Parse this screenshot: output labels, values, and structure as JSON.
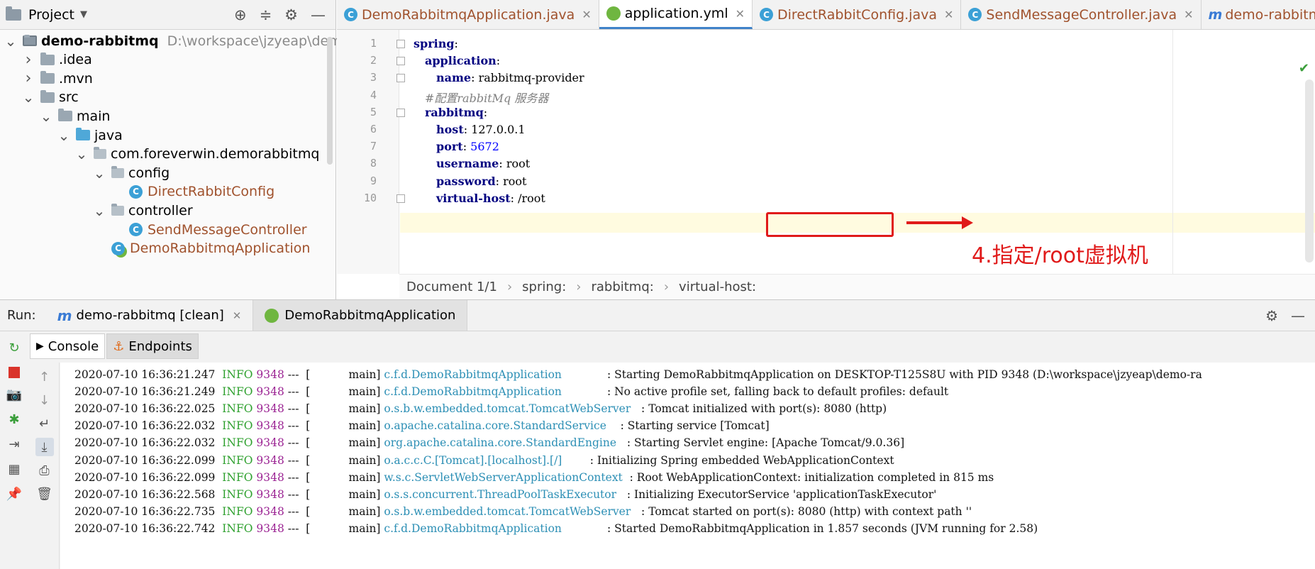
{
  "project_pane": {
    "title": "Project",
    "tree": [
      {
        "label": "demo-rabbitmq",
        "extra": "D:\\workspace\\jzyeap\\demo-ra",
        "depth": 0,
        "arrow": "down",
        "icon": "module-folder-icon"
      },
      {
        "label": ".idea",
        "depth": 1,
        "arrow": "right",
        "icon": "folder-icon"
      },
      {
        "label": ".mvn",
        "depth": 1,
        "arrow": "right",
        "icon": "folder-icon"
      },
      {
        "label": "src",
        "depth": 1,
        "arrow": "down",
        "icon": "folder-icon"
      },
      {
        "label": "main",
        "depth": 2,
        "arrow": "down",
        "icon": "folder-icon"
      },
      {
        "label": "java",
        "depth": 3,
        "arrow": "down",
        "icon": "source-folder-icon"
      },
      {
        "label": "com.foreverwin.demorabbitmq",
        "depth": 4,
        "arrow": "down",
        "icon": "package-icon"
      },
      {
        "label": "config",
        "depth": 5,
        "arrow": "down",
        "icon": "package-icon"
      },
      {
        "label": "DirectRabbitConfig",
        "depth": 6,
        "arrow": "",
        "icon": "class-icon"
      },
      {
        "label": "controller",
        "depth": 5,
        "arrow": "down",
        "icon": "package-icon"
      },
      {
        "label": "SendMessageController",
        "depth": 6,
        "arrow": "",
        "icon": "class-icon"
      },
      {
        "label": "DemoRabbitmqApplication",
        "depth": 5,
        "arrow": "",
        "icon": "spring-class-icon"
      }
    ]
  },
  "editor": {
    "tabs": [
      {
        "label": "DemoRabbitmqApplication.java",
        "icon": "spring-class-icon",
        "active": false
      },
      {
        "label": "application.yml",
        "icon": "yaml-spring-icon",
        "active": true
      },
      {
        "label": "DirectRabbitConfig.java",
        "icon": "class-icon",
        "active": false
      },
      {
        "label": "SendMessageController.java",
        "icon": "class-icon",
        "active": false
      },
      {
        "label": "demo-rabbitmq",
        "icon": "maven-icon",
        "active": false
      }
    ],
    "lines": [
      {
        "n": "1",
        "indent": 0,
        "key": "spring",
        "sep": ":",
        "value": "",
        "kind": "key",
        "fold": true
      },
      {
        "n": "2",
        "indent": 1,
        "key": "application",
        "sep": ":",
        "value": "",
        "kind": "key",
        "fold": true
      },
      {
        "n": "3",
        "indent": 2,
        "key": "name",
        "sep": ": ",
        "value": "rabbitmq-provider",
        "kind": "str",
        "fold": true
      },
      {
        "n": "4",
        "indent": 1,
        "key": "",
        "sep": "",
        "value": "#配置rabbitMq 服务器",
        "kind": "comment",
        "fold": false
      },
      {
        "n": "5",
        "indent": 1,
        "key": "rabbitmq",
        "sep": ":",
        "value": "",
        "kind": "key",
        "fold": true
      },
      {
        "n": "6",
        "indent": 2,
        "key": "host",
        "sep": ": ",
        "value": "127.0.0.1",
        "kind": "str",
        "fold": false
      },
      {
        "n": "7",
        "indent": 2,
        "key": "port",
        "sep": ": ",
        "value": "5672",
        "kind": "num",
        "fold": false
      },
      {
        "n": "8",
        "indent": 2,
        "key": "username",
        "sep": ": ",
        "value": "root",
        "kind": "str",
        "fold": false
      },
      {
        "n": "9",
        "indent": 2,
        "key": "password",
        "sep": ": ",
        "value": "root",
        "kind": "str",
        "fold": false
      },
      {
        "n": "10",
        "indent": 2,
        "key": "virtual-host",
        "sep": ": ",
        "value": "/root",
        "kind": "str",
        "fold": true
      }
    ],
    "annotation": "4.指定/root虚拟机",
    "breadcrumb": [
      "Document 1/1",
      "spring:",
      "rabbitmq:",
      "virtual-host:"
    ]
  },
  "run": {
    "title": "Run:",
    "tabs": [
      {
        "label": "demo-rabbitmq [clean]",
        "icon": "maven-icon",
        "active": false
      },
      {
        "label": "DemoRabbitmqApplication",
        "icon": "spring-boot-icon",
        "active": true
      }
    ],
    "subtabs": {
      "console": "Console",
      "endpoints": "Endpoints"
    },
    "log": [
      {
        "ts": "2020-07-10 16:36:21.247",
        "level": "INFO",
        "pid": "9348",
        "thread": "---  [           main]",
        "logger": "c.f.d.DemoRabbitmqApplication",
        "msg": ": Starting DemoRabbitmqApplication on DESKTOP-T125S8U with PID 9348 (D:\\workspace\\jzyeap\\demo-ra"
      },
      {
        "ts": "2020-07-10 16:36:21.249",
        "level": "INFO",
        "pid": "9348",
        "thread": "---  [           main]",
        "logger": "c.f.d.DemoRabbitmqApplication",
        "msg": ": No active profile set, falling back to default profiles: default"
      },
      {
        "ts": "2020-07-10 16:36:22.025",
        "level": "INFO",
        "pid": "9348",
        "thread": "---  [           main]",
        "logger": "o.s.b.w.embedded.tomcat.TomcatWebServer",
        "msg": ": Tomcat initialized with port(s): 8080 (http)"
      },
      {
        "ts": "2020-07-10 16:36:22.032",
        "level": "INFO",
        "pid": "9348",
        "thread": "---  [           main]",
        "logger": "o.apache.catalina.core.StandardService",
        "msg": ": Starting service [Tomcat]"
      },
      {
        "ts": "2020-07-10 16:36:22.032",
        "level": "INFO",
        "pid": "9348",
        "thread": "---  [           main]",
        "logger": "org.apache.catalina.core.StandardEngine",
        "msg": ": Starting Servlet engine: [Apache Tomcat/9.0.36]"
      },
      {
        "ts": "2020-07-10 16:36:22.099",
        "level": "INFO",
        "pid": "9348",
        "thread": "---  [           main]",
        "logger": "o.a.c.c.C.[Tomcat].[localhost].[/]",
        "msg": ": Initializing Spring embedded WebApplicationContext"
      },
      {
        "ts": "2020-07-10 16:36:22.099",
        "level": "INFO",
        "pid": "9348",
        "thread": "---  [           main]",
        "logger": "w.s.c.ServletWebServerApplicationContext",
        "msg": ": Root WebApplicationContext: initialization completed in 815 ms"
      },
      {
        "ts": "2020-07-10 16:36:22.568",
        "level": "INFO",
        "pid": "9348",
        "thread": "---  [           main]",
        "logger": "o.s.s.concurrent.ThreadPoolTaskExecutor",
        "msg": ": Initializing ExecutorService 'applicationTaskExecutor'"
      },
      {
        "ts": "2020-07-10 16:36:22.735",
        "level": "INFO",
        "pid": "9348",
        "thread": "---  [           main]",
        "logger": "o.s.b.w.embedded.tomcat.TomcatWebServer",
        "msg": ": Tomcat started on port(s): 8080 (http) with context path ''"
      },
      {
        "ts": "2020-07-10 16:36:22.742",
        "level": "INFO",
        "pid": "9348",
        "thread": "---  [           main]",
        "logger": "c.f.d.DemoRabbitmqApplication",
        "msg": ": Started DemoRabbitmqApplication in 1.857 seconds (JVM running for 2.58)"
      }
    ]
  }
}
